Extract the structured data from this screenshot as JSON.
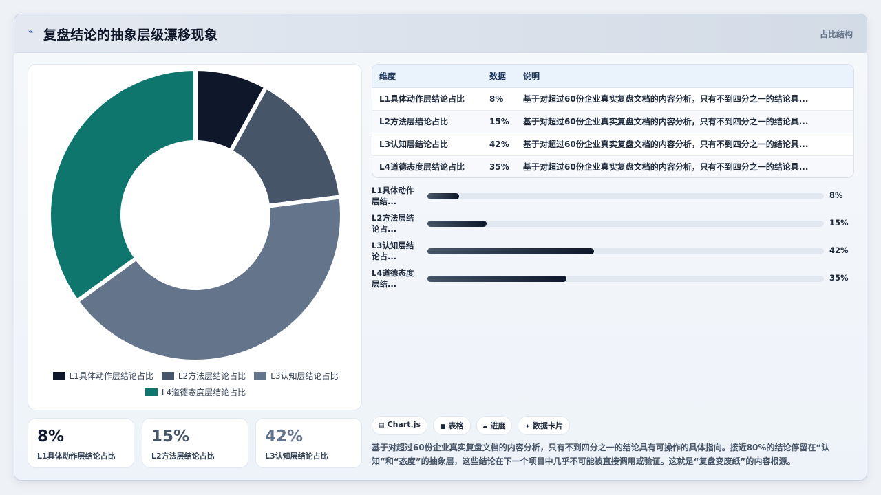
{
  "header": {
    "icon": "bolt-icon",
    "title": "复盘结论的抽象层级漂移现象",
    "tag": "占比结构"
  },
  "colors": {
    "L1": "#0f172a",
    "L2": "#475569",
    "L3": "#64748b",
    "L4": "#0f766e"
  },
  "chart_data": {
    "type": "pie",
    "variant": "doughnut",
    "categories": [
      "L1具体动作层结论占比",
      "L2方法层结论占比",
      "L3认知层结论占比",
      "L4道德态度层结论占比"
    ],
    "values": [
      8,
      15,
      42,
      35
    ],
    "unit": "%",
    "legend_position": "bottom"
  },
  "legend": {
    "items": [
      "L1具体动作层结论占比",
      "L2方法层结论占比",
      "L3认知层结论占比",
      "L4道德态度层结论占比"
    ]
  },
  "kpis": [
    {
      "value": "8%",
      "label": "L1具体动作层结论占比"
    },
    {
      "value": "15%",
      "label": "L2方法层结论占比"
    },
    {
      "value": "42%",
      "label": "L3认知层结论占比"
    }
  ],
  "table": {
    "headers": [
      "维度",
      "数据",
      "说明"
    ],
    "rows": [
      [
        "L1具体动作层结论占比",
        "8%",
        "基于对超过60份企业真实复盘文档的内容分析，只有不到四分之一的结论具..."
      ],
      [
        "L2方法层结论占比",
        "15%",
        "基于对超过60份企业真实复盘文档的内容分析，只有不到四分之一的结论具..."
      ],
      [
        "L3认知层结论占比",
        "42%",
        "基于对超过60份企业真实复盘文档的内容分析，只有不到四分之一的结论具..."
      ],
      [
        "L4道德态度层结论占比",
        "35%",
        "基于对超过60份企业真实复盘文档的内容分析，只有不到四分之一的结论具..."
      ]
    ]
  },
  "progress": [
    {
      "label": "L1具体动作层结...",
      "value": 8,
      "text": "8%"
    },
    {
      "label": "L2方法层结论占...",
      "value": 15,
      "text": "15%"
    },
    {
      "label": "L3认知层结论占...",
      "value": 42,
      "text": "42%"
    },
    {
      "label": "L4道德态度层结...",
      "value": 35,
      "text": "35%"
    }
  ],
  "chips": [
    {
      "icon": "chart-icon",
      "glyph": "▤",
      "label": "Chart.js"
    },
    {
      "icon": "table-icon",
      "glyph": "■",
      "label": "表格"
    },
    {
      "icon": "progress-icon",
      "glyph": "▰",
      "label": "进度"
    },
    {
      "icon": "sparkle-icon",
      "glyph": "✦",
      "label": "数据卡片"
    }
  ],
  "note": "基于对超过60份企业真实复盘文档的内容分析，只有不到四分之一的结论具有可操作的具体指向。接近80%的结论停留在“认知”和“态度”的抽象层，这些结论在下一个项目中几乎不可能被直接调用或验证。这就是“复盘变废纸”的内容根源。"
}
